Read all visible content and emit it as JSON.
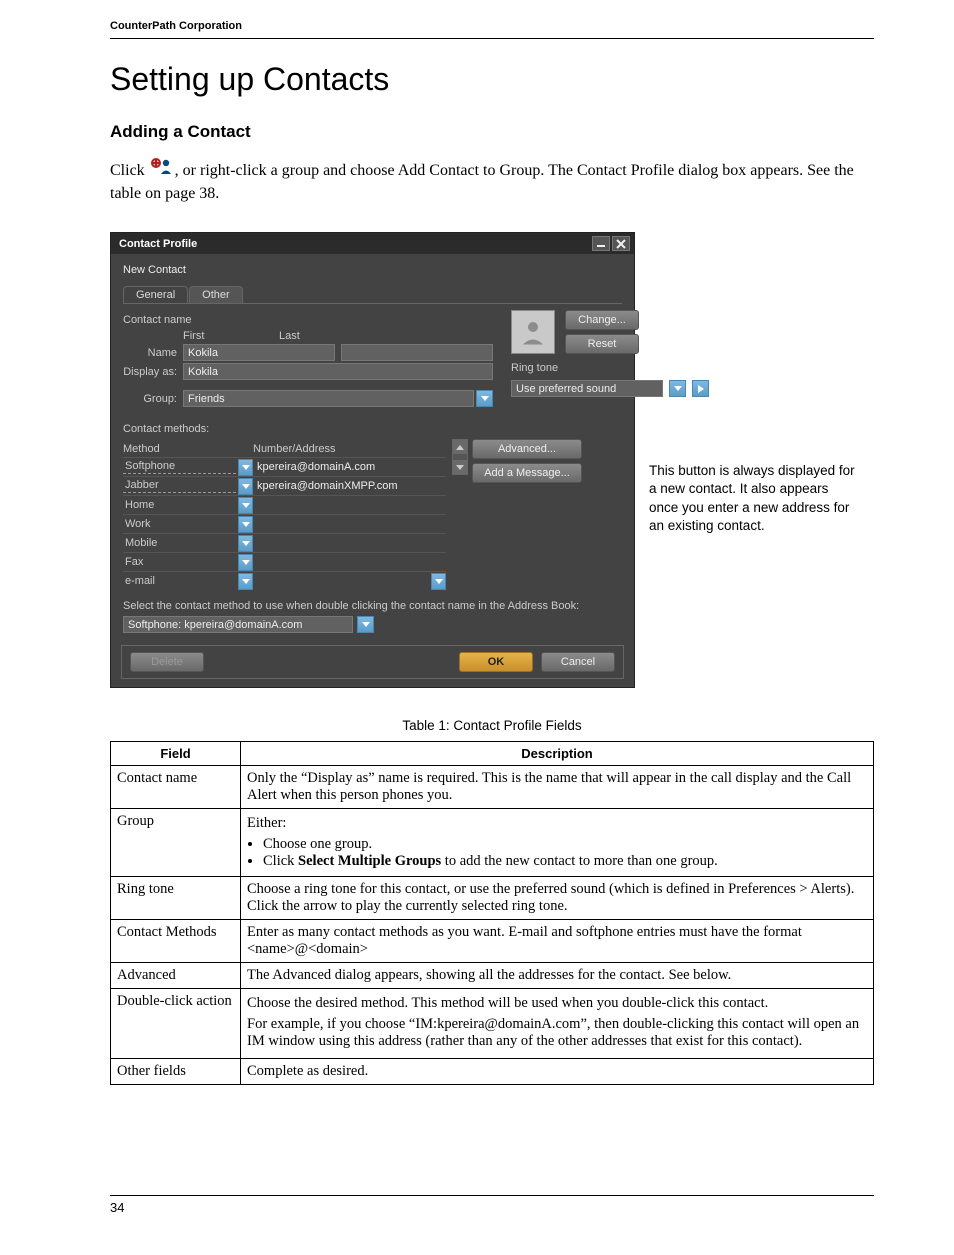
{
  "runhead": "CounterPath Corporation",
  "title": "Setting up Contacts",
  "section": "Adding a Contact",
  "intro_pre": "Click ",
  "intro_post": ", or right-click a group and choose Add Contact to Group. The Contact Profile dialog box appears. See the table on page 38.",
  "dialog": {
    "title": "Contact Profile",
    "new_contact": "New Contact",
    "tabs": {
      "general": "General",
      "other": "Other"
    },
    "contact_name_hdr": "Contact name",
    "first": "First",
    "last": "Last",
    "name_lbl": "Name",
    "name_val": "Kokila",
    "displayas_lbl": "Display as:",
    "displayas_val": "Kokila",
    "group_lbl": "Group:",
    "group_val": "Friends",
    "change_btn": "Change...",
    "reset_btn": "Reset",
    "ringtone_lbl": "Ring tone",
    "ringtone_val": "Use preferred sound",
    "contact_methods_hdr": "Contact methods:",
    "method_hdr": "Method",
    "addr_hdr": "Number/Address",
    "methods": [
      {
        "label": "Softphone",
        "addr": "kpereira@domainA.com",
        "dashed": true
      },
      {
        "label": "Jabber",
        "addr": "kpereira@domainXMPP.com",
        "dashed": true
      },
      {
        "label": "Home",
        "addr": "",
        "dashed": false
      },
      {
        "label": "Work",
        "addr": "",
        "dashed": false
      },
      {
        "label": "Mobile",
        "addr": "",
        "dashed": false
      },
      {
        "label": "Fax",
        "addr": "",
        "dashed": false
      },
      {
        "label": "e-mail",
        "addr": "",
        "dashed": false
      }
    ],
    "advanced_btn": "Advanced...",
    "add_msg_btn": "Add a Message...",
    "select_note": "Select the contact method to use when double clicking the contact name in the Address Book:",
    "primary_val": "Softphone: kpereira@domainA.com",
    "delete_btn": "Delete",
    "ok_btn": "OK",
    "cancel_btn": "Cancel"
  },
  "callout": "This button is always displayed for a new contact. It also appears once you enter a new address for an existing contact.",
  "table": {
    "caption": "Table 1: Contact Profile Fields",
    "head_field": "Field",
    "head_desc": "Description",
    "rows": [
      {
        "f": "Contact name",
        "d": "Only the “Display as” name is required. This is the name that will appear in the call display and the Call Alert when this person phones you."
      },
      {
        "f": "Group",
        "d_intro": "Either:",
        "d_items": [
          "Choose one group.",
          "Click <b>Select Multiple Groups</b> to add the new contact to more than one group."
        ]
      },
      {
        "f": "Ring tone",
        "d": "Choose a ring tone for this contact, or use the preferred sound (which is defined in Preferences > Alerts). Click the arrow to play the currently selected ring tone."
      },
      {
        "f": "Contact Methods",
        "d": "Enter as many contact methods as you want. E-mail and softphone entries must have the format <name>@<domain>"
      },
      {
        "f": "Advanced",
        "d": "The Advanced dialog appears, showing all the addresses for the contact. See below."
      },
      {
        "f": "Double-click action",
        "d_p1": "Choose the desired method. This method will be used when you double-click this contact.",
        "d_p2": "For example, if you choose “IM:kpereira@domainA.com”, then double-clicking this contact will open an IM window using this address (rather than any of the other addresses that exist for this contact)."
      },
      {
        "f": "Other fields",
        "d": "Complete as desired."
      }
    ]
  },
  "page_number": "34"
}
